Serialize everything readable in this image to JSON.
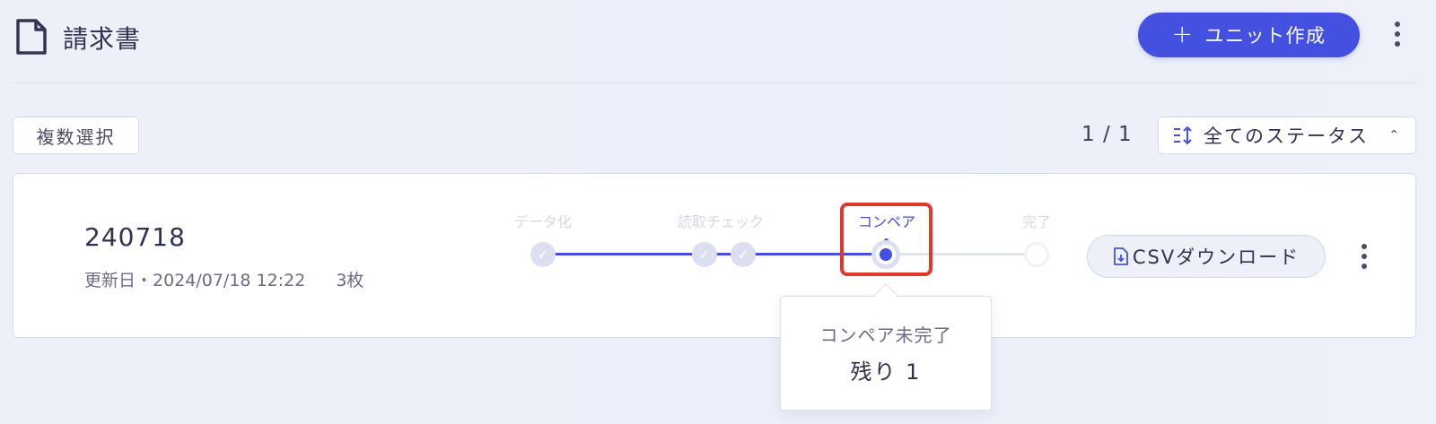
{
  "header": {
    "title": "請求書",
    "create_button_label": "ユニット作成",
    "create_button_icon": "plus-icon"
  },
  "toolbar": {
    "multi_select_label": "複数選択",
    "pager": "1 / 1",
    "status_filter": "全てのステータス"
  },
  "unit": {
    "name": "240718",
    "updated": "更新日・2024/07/18 12:22",
    "pages": "3枚",
    "csv_button_label": "CSVダウンロード"
  },
  "stepper": {
    "steps": [
      {
        "label": "データ化",
        "state": "done"
      },
      {
        "label": "読取チェック",
        "state": "done"
      },
      {
        "label": "コンペア",
        "state": "current"
      },
      {
        "label": "完了",
        "state": "todo"
      }
    ]
  },
  "tooltip": {
    "title": "コンペア未完了",
    "value": "残り 1"
  },
  "colors": {
    "accent": "#4451e0",
    "highlight": "#e0392b"
  }
}
